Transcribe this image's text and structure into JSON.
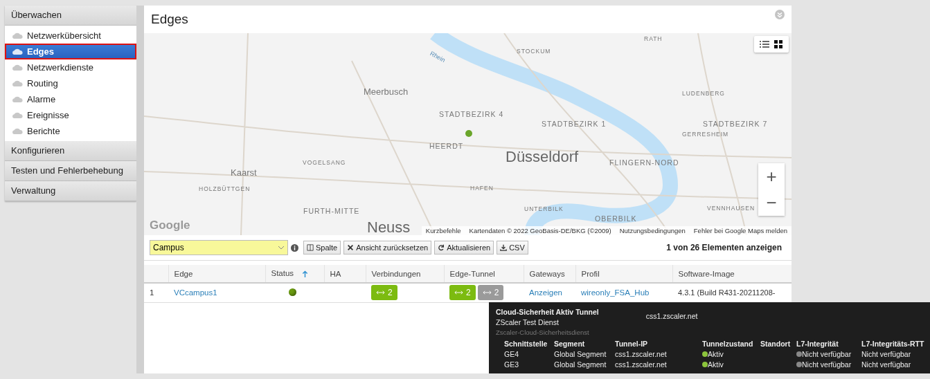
{
  "sidebar": {
    "sections": [
      {
        "label": "Überwachen",
        "items": [
          {
            "label": "Netzwerkübersicht",
            "selected": false
          },
          {
            "label": "Edges",
            "selected": true
          },
          {
            "label": "Netzwerkdienste",
            "selected": false
          },
          {
            "label": "Routing",
            "selected": false
          },
          {
            "label": "Alarme",
            "selected": false
          },
          {
            "label": "Ereignisse",
            "selected": false
          },
          {
            "label": "Berichte",
            "selected": false
          }
        ]
      },
      {
        "label": "Konfigurieren"
      },
      {
        "label": "Testen und Fehlerbehebung"
      },
      {
        "label": "Verwaltung"
      }
    ]
  },
  "page": {
    "title": "Edges"
  },
  "map": {
    "labels": [
      {
        "text": "RATH",
        "kind": "district"
      },
      {
        "text": "STOCKUM",
        "kind": "district"
      },
      {
        "text": "Rhein",
        "kind": "water"
      },
      {
        "text": "Meerbusch",
        "kind": "town"
      },
      {
        "text": "LUDENBERG",
        "kind": "district"
      },
      {
        "text": "STADTBEZIRK 4",
        "kind": "area"
      },
      {
        "text": "STADTBEZIRK 1",
        "kind": "area"
      },
      {
        "text": "STADTBEZIRK 7",
        "kind": "area"
      },
      {
        "text": "GERRESHEIM",
        "kind": "district"
      },
      {
        "text": "HEERDT",
        "kind": "area"
      },
      {
        "text": "VOGELSANG",
        "kind": "district"
      },
      {
        "text": "Düsseldorf",
        "kind": "city"
      },
      {
        "text": "FLINGERN-NORD",
        "kind": "area"
      },
      {
        "text": "Kaarst",
        "kind": "town"
      },
      {
        "text": "HOLZBÜTTGEN",
        "kind": "district"
      },
      {
        "text": "HAFEN",
        "kind": "district"
      },
      {
        "text": "FURTH-MITTE",
        "kind": "area"
      },
      {
        "text": "UNTERBILK",
        "kind": "district"
      },
      {
        "text": "VENNHAUSEN",
        "kind": "district"
      },
      {
        "text": "OBERBILK",
        "kind": "area"
      },
      {
        "text": "Neuss",
        "kind": "city"
      }
    ],
    "view_modes": [
      {
        "kind": "list",
        "selected": false
      },
      {
        "kind": "grid",
        "selected": true
      }
    ],
    "logo": "Google",
    "attribution": [
      "Kurzbefehle",
      "Kartendaten © 2022 GeoBasis-DE/BKG (©2009)",
      "Nutzungsbedingungen",
      "Fehler bei Google Maps melden"
    ],
    "zoom_in": "+",
    "zoom_out": "−"
  },
  "toolbar": {
    "filter": {
      "value": "Campus"
    },
    "buttons": [
      {
        "label": "Spalte",
        "kind": "columns"
      },
      {
        "label": "Ansicht zurücksetzen",
        "kind": "reset"
      },
      {
        "label": "Aktualisieren",
        "kind": "refresh"
      },
      {
        "label": "CSV",
        "kind": "download"
      }
    ],
    "count": "1 von 26 Elementen anzeigen"
  },
  "table": {
    "columns": [
      {
        "sorted": false
      },
      {
        "label": "Edge",
        "sorted": false
      },
      {
        "label": "Status",
        "sorted": true
      },
      {
        "label": "HA",
        "sorted": false
      },
      {
        "label": "Verbindungen",
        "sorted": false
      },
      {
        "label": "Edge-Tunnel",
        "sorted": false
      },
      {
        "label": "Gateways",
        "sorted": false
      },
      {
        "label": "Profil",
        "sorted": false
      },
      {
        "label": "Software-Image",
        "sorted": false
      }
    ],
    "rows": [
      {
        "index": "1",
        "edge": "VCcampus1",
        "status": {
          "color": "#6a9a10"
        },
        "connections": "2",
        "tunnels": [
          {
            "count": "2",
            "active": true
          },
          {
            "count": "2",
            "active": false
          }
        ],
        "gateways": "Anzeigen",
        "profile": "wireonly_FSA_Hub",
        "software": "4.3.1 (Build R431-20211208-"
      }
    ]
  },
  "tooltip": {
    "title": "Cloud-Sicherheit Aktiv Tunnel",
    "host": "css1.zscaler.net",
    "service": "ZScaler Test Dienst",
    "subtitle": "Zscaler-Cloud-Sicherheitsdienst",
    "columns": [
      "Schnittstelle",
      "Segment",
      "Tunnel-IP",
      "Tunnelzustand",
      "Standort",
      "L7-Integrität",
      "L7-Integritäts-RTT"
    ],
    "rows": [
      {
        "interface": "GE4",
        "segment": "Global Segment",
        "ip": "css1.zscaler.net",
        "state": {
          "label": "Aktiv",
          "color": "#8cc43c"
        },
        "l7": {
          "label": "Nicht verfügbar",
          "color": "#888888"
        },
        "rtt": "Nicht verfügbar"
      },
      {
        "interface": "GE3",
        "segment": "Global Segment",
        "ip": "css1.zscaler.net",
        "state": {
          "label": "Aktiv",
          "color": "#8cc43c"
        },
        "l7": {
          "label": "Nicht verfügbar",
          "color": "#888888"
        },
        "rtt": "Nicht verfügbar"
      }
    ]
  }
}
